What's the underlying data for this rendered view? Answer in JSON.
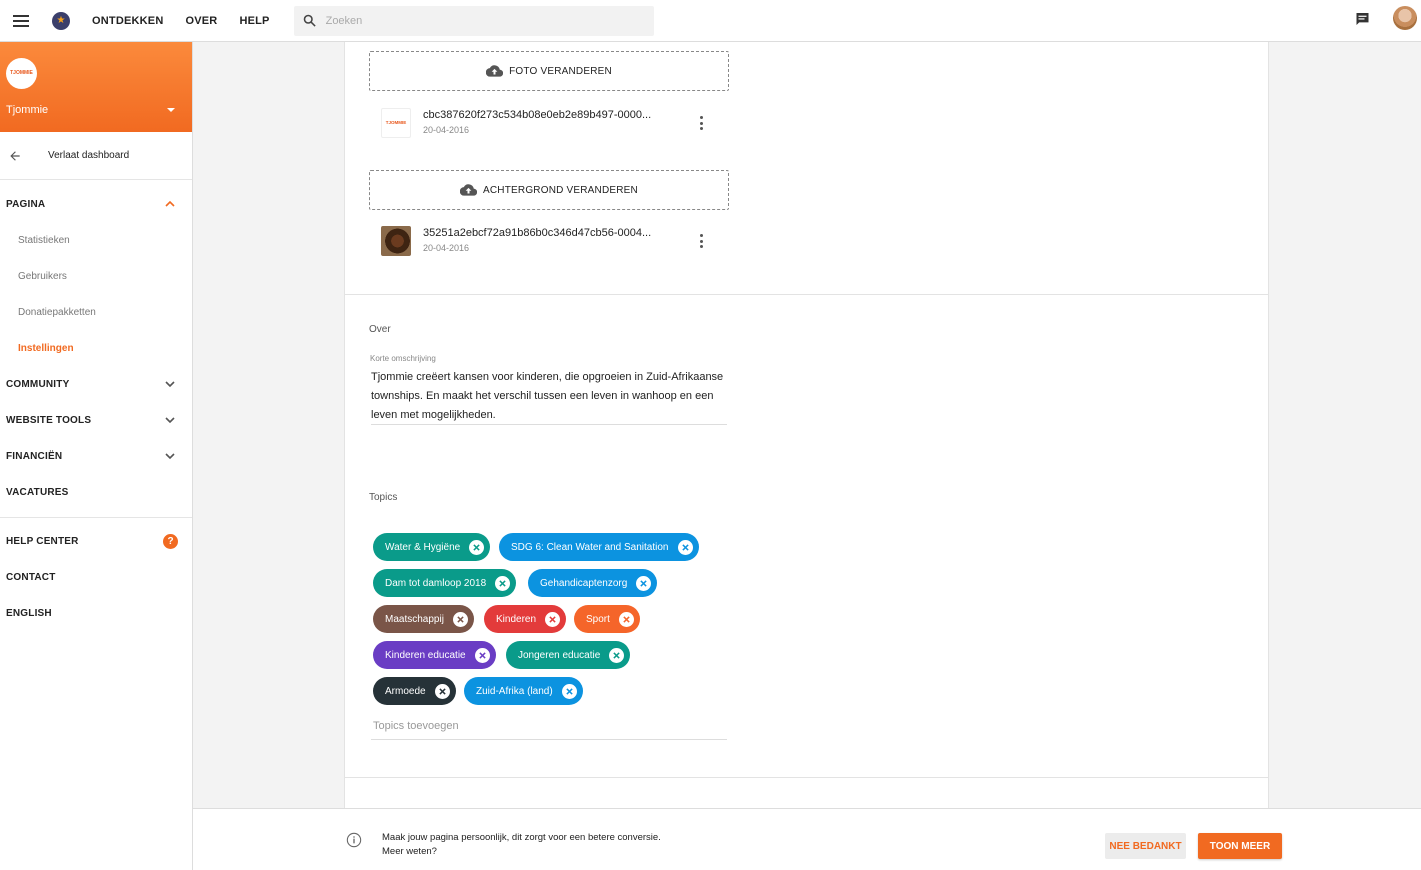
{
  "topbar": {
    "nav": [
      "ONTDEKKEN",
      "OVER",
      "HELP"
    ],
    "search_placeholder": "Zoeken"
  },
  "sidebar": {
    "org_logo_text": "TJOMMIE",
    "org_name": "Tjommie",
    "leave_label": "Verlaat dashboard",
    "sections": {
      "pagina": "PAGINA",
      "community": "COMMUNITY",
      "website_tools": "WEBSITE TOOLS",
      "financien": "FINANCIËN",
      "vacatures": "VACATURES",
      "help_center": "HELP CENTER",
      "contact": "CONTACT",
      "english": "ENGLISH"
    },
    "pagina_items": [
      "Statistieken",
      "Gebruikers",
      "Donatiepakketten",
      "Instellingen"
    ],
    "active_item": "Instellingen",
    "help_badge": "?"
  },
  "media": {
    "photo_button": "FOTO VERANDEREN",
    "photo_file": {
      "name": "cbc387620f273c534b08e0eb2e89b497-0000...",
      "date": "20-04-2016"
    },
    "background_button": "ACHTERGROND VERANDEREN",
    "background_file": {
      "name": "35251a2ebcf72a91b86b0c346d47cb56-0004...",
      "date": "20-04-2016"
    }
  },
  "about": {
    "title": "Over",
    "short_label": "Korte omschrijving",
    "short_value": "Tjommie creëert kansen voor kinderen, die opgroeien in Zuid-Afrikaanse townships. En maakt het verschil tussen een leven in wanhoop en een leven met mogelijkheden."
  },
  "topics": {
    "title": "Topics",
    "placeholder": "Topics toevoegen",
    "chips": [
      {
        "label": "Water & Hygiëne",
        "color": "#0a9b8a"
      },
      {
        "label": "SDG 6: Clean Water and Sanitation",
        "color": "#0c93e0"
      },
      {
        "label": "Dam tot damloop 2018",
        "color": "#0a9b8a"
      },
      {
        "label": "Gehandicaptenzorg",
        "color": "#0c93e0"
      },
      {
        "label": "Maatschappij",
        "color": "#7a5548"
      },
      {
        "label": "Kinderen",
        "color": "#e33b3b"
      },
      {
        "label": "Sport",
        "color": "#f5652a"
      },
      {
        "label": "Kinderen educatie",
        "color": "#6a3dc4"
      },
      {
        "label": "Jongeren educatie",
        "color": "#0a9b8a"
      },
      {
        "label": "Armoede",
        "color": "#263238"
      },
      {
        "label": "Zuid-Afrika (land)",
        "color": "#0c93e0"
      }
    ]
  },
  "notice": {
    "text": "Maak jouw pagina persoonlijk, dit zorgt voor een betere conversie. Meer weten?",
    "decline": "NEE BEDANKT",
    "more": "TOON MEER"
  },
  "colors": {
    "accent": "#f16a21"
  }
}
